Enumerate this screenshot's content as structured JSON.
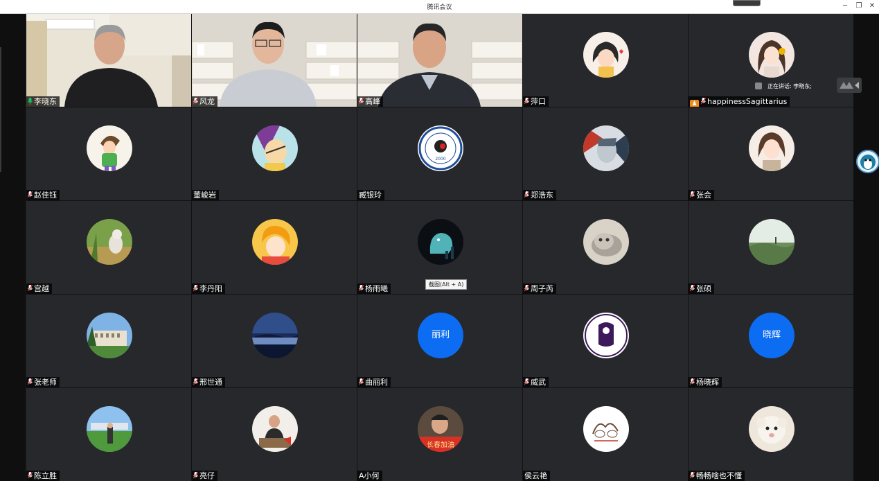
{
  "window": {
    "title": "腾讯会议",
    "buttons": [
      "minimize",
      "restore",
      "close"
    ]
  },
  "speaking": {
    "label": "正在讲话: 李晓东;"
  },
  "tooltip": {
    "text": "截图(Alt + A)"
  },
  "tiles": [
    {
      "name": "李晓东",
      "mic": "active",
      "kind": "video"
    },
    {
      "name": "风龙",
      "mic": "muted",
      "kind": "video"
    },
    {
      "name": "高峰",
      "mic": "muted",
      "kind": "video"
    },
    {
      "name": "萍口",
      "mic": "muted",
      "kind": "avatar",
      "avatar": "cartoon-girl"
    },
    {
      "name": "happinessSagittarius",
      "mic": "muted",
      "kind": "avatar",
      "avatar": "girl-with-rose",
      "host": true
    },
    {
      "name": "赵佳钰",
      "mic": "muted",
      "kind": "avatar",
      "avatar": "cartoon-boy"
    },
    {
      "name": "董峻岩",
      "mic": "none",
      "kind": "avatar",
      "avatar": "anime-character"
    },
    {
      "name": "臧银玲",
      "mic": "none",
      "kind": "avatar",
      "avatar": "school-emblem",
      "avatar_text": "2000"
    },
    {
      "name": "郑浩东",
      "mic": "muted",
      "kind": "avatar",
      "avatar": "art-face"
    },
    {
      "name": "张会",
      "mic": "muted",
      "kind": "avatar",
      "avatar": "illustrated-girl"
    },
    {
      "name": "宫越",
      "mic": "muted",
      "kind": "avatar",
      "avatar": "cat-in-grass"
    },
    {
      "name": "李丹阳",
      "mic": "muted",
      "kind": "avatar",
      "avatar": "cartoon-child"
    },
    {
      "name": "杨雨曦",
      "mic": "muted",
      "kind": "avatar",
      "avatar": "night-dinosaur"
    },
    {
      "name": "周子芮",
      "mic": "muted",
      "kind": "avatar",
      "avatar": "kitten"
    },
    {
      "name": "张硕",
      "mic": "muted",
      "kind": "avatar",
      "avatar": "meadow"
    },
    {
      "name": "张老师",
      "mic": "muted",
      "kind": "avatar",
      "avatar": "building"
    },
    {
      "name": "邢世通",
      "mic": "muted",
      "kind": "avatar",
      "avatar": "sunset-lake"
    },
    {
      "name": "曲丽利",
      "mic": "muted",
      "kind": "text-avatar",
      "avatar_text": "丽利"
    },
    {
      "name": "威武",
      "mic": "muted",
      "kind": "avatar",
      "avatar": "premier-league"
    },
    {
      "name": "杨晓辉",
      "mic": "muted",
      "kind": "text-avatar",
      "avatar_text": "晓辉"
    },
    {
      "name": "陈立胜",
      "mic": "muted",
      "kind": "avatar",
      "avatar": "man-on-field"
    },
    {
      "name": "亮仔",
      "mic": "muted",
      "kind": "avatar",
      "avatar": "man-at-desk"
    },
    {
      "name": "A小何",
      "mic": "none",
      "kind": "avatar",
      "avatar": "car-selfie",
      "avatar_text": "长春加油"
    },
    {
      "name": "侯云艳",
      "mic": "none",
      "kind": "avatar",
      "avatar": "sketch"
    },
    {
      "name": "畅畅啥也不懂",
      "mic": "muted",
      "kind": "avatar",
      "avatar": "lamb"
    }
  ],
  "colors": {
    "accent": "#19c36a",
    "tile_bg": "#26282b",
    "text_avatar": "#0c6cf2",
    "host_badge": "#f18a1c"
  }
}
